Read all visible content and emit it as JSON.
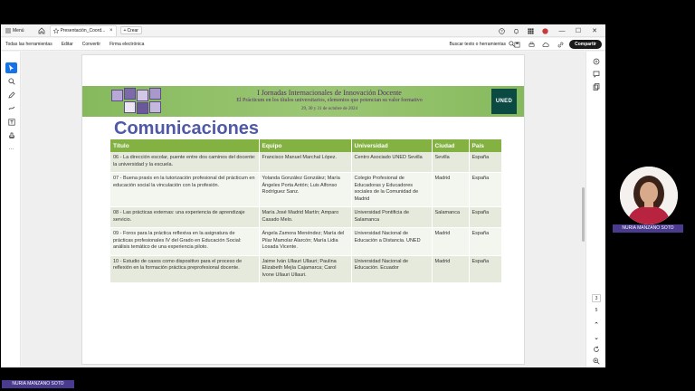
{
  "window": {
    "menu_label": "Menú",
    "tab_title": "Presentación_Coord...",
    "new_label": "Crear"
  },
  "toolbar": {
    "all_tools": "Todas las herramientas",
    "edit": "Editar",
    "convert": "Convertir",
    "e_sign": "Firma electrónica",
    "search": "Buscar texto o herramientas",
    "share": "Compartir"
  },
  "pagination": {
    "current": "3",
    "total": "5"
  },
  "slide": {
    "banner_title": "I Jornadas Internacionales de Innovación Docente",
    "banner_subtitle": "El Prácticum en los títulos universitarios, elementos que potencian su valor formativo",
    "banner_dates": "29, 30 y 31 de octubre de 2024",
    "logo": "UNED",
    "heading": "Comunicaciones",
    "table": {
      "headers": [
        "Título",
        "Equipo",
        "Universidad",
        "Ciudad",
        "País"
      ],
      "rows": [
        {
          "title": "06 - La dirección escolar, puente entre dos caminos del docente: la universidad y la escuela.",
          "team": "Francisco Manuel Marchal López.",
          "university": "Centro Asociado UNED Sevilla",
          "city": "Sevilla",
          "country": "España"
        },
        {
          "title": "07 - Buena praxis en la tutorización profesional del prácticum en educación social la vinculación con la profesión.",
          "team": "Yolanda González González; María Ángeles Porta Antón; Luis Alfonso Rodríguez Sanz.",
          "university": "Colegio Profesional de Educadoras y Educadores sociales de la Comunidad de Madrid",
          "city": "Madrid",
          "country": "España"
        },
        {
          "title": "08 - Las prácticas externas: una experiencia de aprendizaje servicio.",
          "team": "María José Madrid Martín; Amparo Casado Melo.",
          "university": "Universidad Pontificia de Salamanca",
          "city": "Salamanca",
          "country": "España"
        },
        {
          "title": "09 - Foros para la práctica reflexiva en la asignatura de prácticas profesionales IV del Grado en Educación Social: análisis temático de una experiencia piloto.",
          "team": "Ángela Zamora Menéndez; María del Pilar Mamolar Alarcón; María Lidia Losada Vicente.",
          "university": "Universidad Nacional de Educación a Distancia. UNED",
          "city": "Madrid",
          "country": "España"
        },
        {
          "title": "10 - Estudio de casos como dispositivo para el proceso de reflexión en la formación práctica preprofesional docente.",
          "team": "Jaime Iván Ullauri Ullauri; Paulina Elizabeth Mejía Cajamarca; Carol Ivone Ullauri Ullauri.",
          "university": "Universidad Nacional de Educación. Ecuador",
          "city": "Madrid",
          "country": "España"
        }
      ]
    }
  },
  "participants": {
    "cam_name": "NURIA MANZANO SOTO",
    "bottom_name": "NURIA MANZANO SOTO"
  },
  "colors": {
    "table_header": "#84b242",
    "heading": "#4f59a8",
    "name_tag": "#4a3b8e",
    "accent_tool": "#1473e6"
  }
}
